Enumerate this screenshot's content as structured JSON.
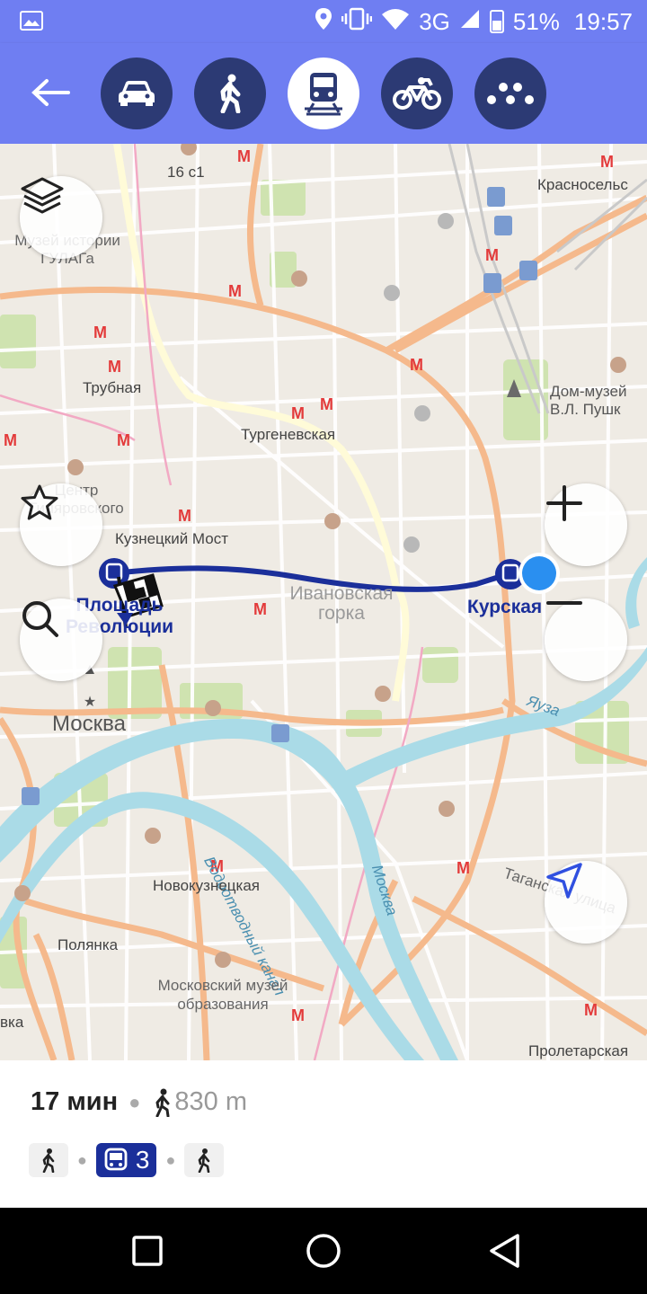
{
  "status_bar": {
    "network": "3G",
    "battery": "51%",
    "time": "19:57"
  },
  "transport_modes": [
    {
      "name": "car",
      "active": false
    },
    {
      "name": "walk",
      "active": false
    },
    {
      "name": "transit",
      "active": true
    },
    {
      "name": "bike",
      "active": false
    },
    {
      "name": "taxi",
      "active": false
    }
  ],
  "map_labels": {
    "house_16c1": "16 с1",
    "krasnoselskaya": "Красносельс",
    "gulag_museum": "Музей истории ГУЛАГа",
    "trubnaya": "Трубная",
    "dom_muzey": "Дом-музей В.Л. Пушк",
    "turgenevskaya": "Тургеневская",
    "centr": "Центр Гиляровского",
    "kuznetsky_most": "Кузнецкий Мост",
    "ivanovskaya_gorka": "Ивановская горка",
    "ploshchad": "Площадь Революции",
    "kurskaya": "Курская",
    "moskva_city": "Москва",
    "yauza": "Яуза",
    "vodootvodny": "Водоотводный канал",
    "moskva_river": "Москва",
    "novokuznetskaya": "Новокузнецкая",
    "taganskaya": "Таганская улица",
    "polyanka": "Полянка",
    "museum_education": "Московский музей образования",
    "proletarskaya": "Пролетарская",
    "edge_vka": "вка"
  },
  "route": {
    "duration": "17 мин",
    "walk_distance": "830 m",
    "transit_line": "3"
  },
  "colors": {
    "accent": "#6f7ef2",
    "mode_bg": "#2c3a74",
    "route": "#1b2f9a",
    "river": "#aadbe7",
    "major_road": "#f5b98c"
  }
}
